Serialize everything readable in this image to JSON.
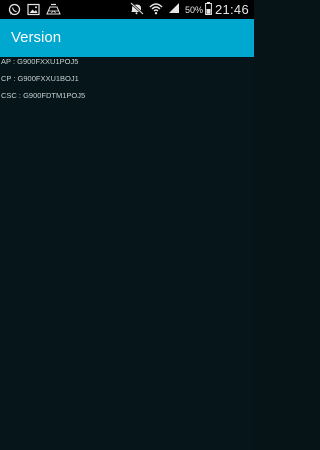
{
  "status_bar": {
    "battery_percent": "50%",
    "time": "21:46",
    "left_icons": [
      "whatsapp-icon",
      "image-notification-icon",
      "mileage-app-icon"
    ],
    "right_icons": [
      "mute-icon",
      "wifi-icon",
      "signal-icon",
      "battery-icon"
    ]
  },
  "action_bar": {
    "title": "Version"
  },
  "versions": [
    {
      "text": "AP : G900FXXU1POJ5"
    },
    {
      "text": "CP : G900FXXU1BOJ1"
    },
    {
      "text": "CSC : G900FDTM1POJ5"
    }
  ],
  "colors": {
    "action_bar": "#00a7cf",
    "background": "#06151a",
    "status_bar": "#000000"
  }
}
